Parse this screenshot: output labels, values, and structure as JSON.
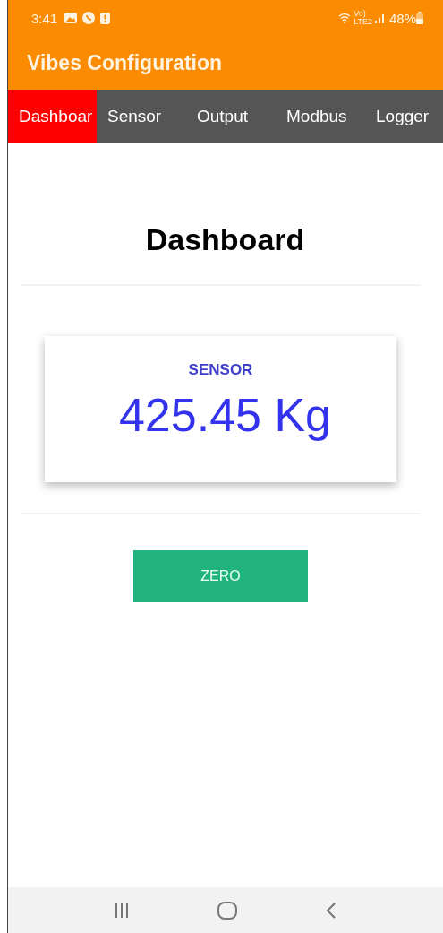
{
  "status_bar": {
    "time": "3:41",
    "network_top": "Vo)",
    "network_bottom": "LTE2",
    "battery": "48%"
  },
  "app_bar": {
    "title": "Vibes Configuration"
  },
  "tabs": [
    {
      "label": "Dashboar",
      "selected": true
    },
    {
      "label": "Sensor",
      "selected": false
    },
    {
      "label": "Output",
      "selected": false
    },
    {
      "label": "Modbus",
      "selected": false
    },
    {
      "label": "Logger",
      "selected": false
    }
  ],
  "page": {
    "heading": "Dashboard"
  },
  "card": {
    "label": "SENSOR",
    "value": "425.45 Kg"
  },
  "buttons": [
    {
      "label": "ZERO"
    }
  ]
}
